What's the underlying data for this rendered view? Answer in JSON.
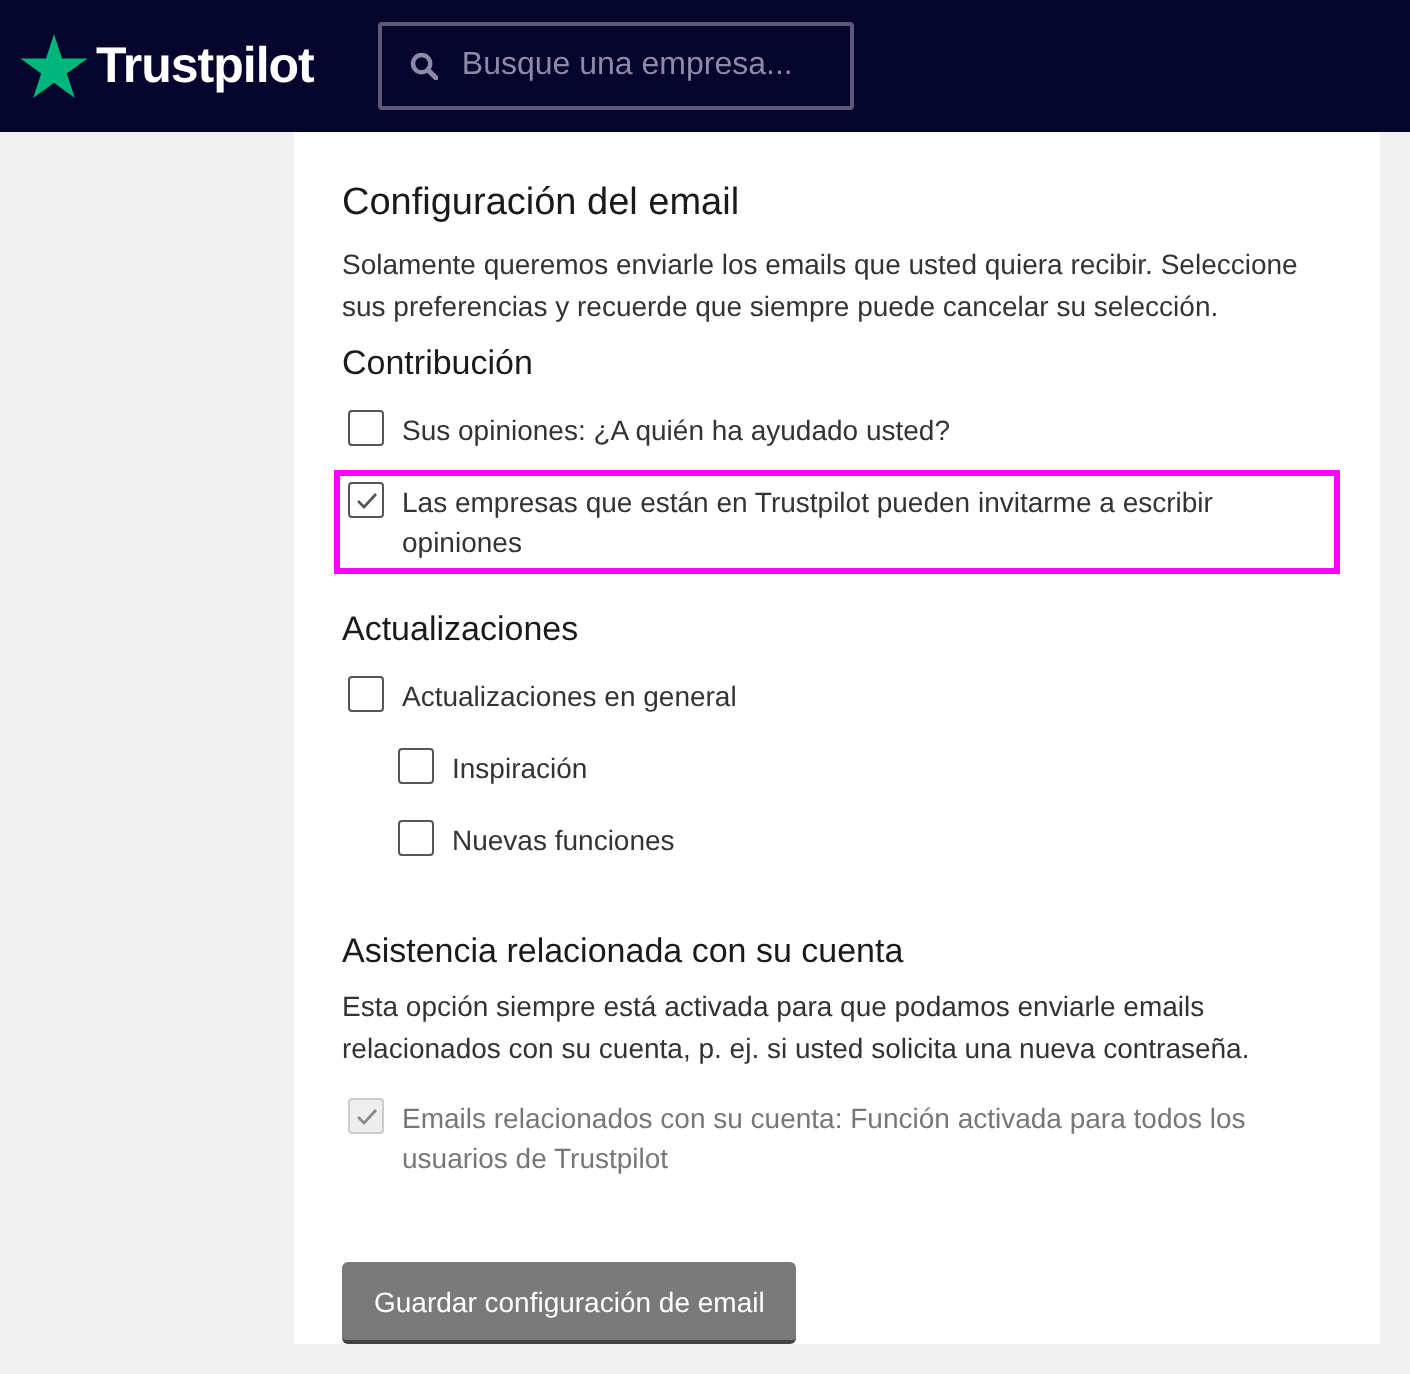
{
  "header": {
    "logo": "Trustpilot",
    "search": {
      "placeholder": "Busque una empresa..."
    }
  },
  "settings": {
    "title": "Configuración del email",
    "description": "Solamente queremos enviarle los emails que usted quiera recibir. Seleccione sus preferencias y recuerde que siempre puede cancelar su selección.",
    "sections": [
      {
        "heading": "Contribución",
        "options": [
          {
            "label": "Sus opiniones: ¿A quién ha ayudado usted?",
            "checked": false,
            "disabled": false,
            "highlighted": false
          },
          {
            "label": "Las empresas que están en Trustpilot pueden invitarme a escribir opiniones",
            "checked": true,
            "disabled": false,
            "highlighted": true
          }
        ]
      },
      {
        "heading": "Actualizaciones",
        "options": [
          {
            "label": "Actualizaciones en general",
            "checked": false,
            "disabled": false,
            "highlighted": false,
            "children": [
              {
                "label": "Inspiración",
                "checked": false,
                "disabled": false,
                "highlighted": false
              },
              {
                "label": "Nuevas funciones",
                "checked": false,
                "disabled": false,
                "highlighted": false
              }
            ]
          }
        ]
      },
      {
        "heading": "Asistencia relacionada con su cuenta",
        "description": "Esta opción siempre está activada para que podamos enviarle emails relacionados con su cuenta, p. ej. si usted solicita una nueva contraseña.",
        "options": [
          {
            "label": "Emails relacionados con su cuenta: Función activada para todos los usuarios de Trustpilot",
            "checked": true,
            "disabled": true,
            "highlighted": false
          }
        ]
      }
    ],
    "save_button": "Guardar configuración de email"
  }
}
